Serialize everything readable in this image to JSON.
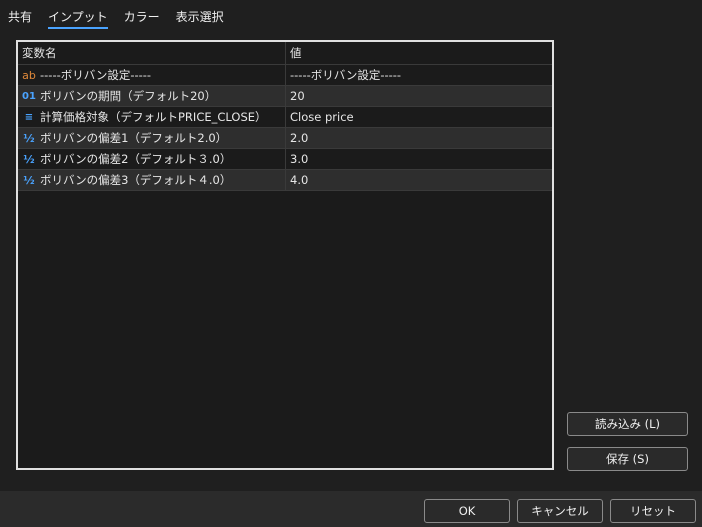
{
  "tabs": [
    {
      "label": "共有"
    },
    {
      "label": "インプット"
    },
    {
      "label": "カラー"
    },
    {
      "label": "表示選択"
    }
  ],
  "grid": {
    "headers": {
      "name": "変数名",
      "value": "値"
    },
    "rows": [
      {
        "icon": "ab",
        "icon_name": "string-type-icon",
        "name": "-----ボリバン設定-----",
        "value": "-----ボリバン設定-----"
      },
      {
        "icon": "01",
        "icon_name": "integer-type-icon",
        "name": "ボリバンの期間（デフォルト20）",
        "value": "20"
      },
      {
        "icon": "≡",
        "icon_name": "enum-type-icon",
        "name": "計算価格対象（デフォルトPRICE_CLOSE）",
        "value": "Close price"
      },
      {
        "icon": "½",
        "icon_name": "double-type-icon",
        "name": "ボリバンの偏差1（デフォルト2.0）",
        "value": "2.0"
      },
      {
        "icon": "½",
        "icon_name": "double-type-icon",
        "name": "ボリバンの偏差2（デフォルト３.0）",
        "value": "3.0"
      },
      {
        "icon": "½",
        "icon_name": "double-type-icon",
        "name": "ボリバンの偏差3（デフォルト４.0）",
        "value": "4.0"
      }
    ]
  },
  "side_buttons": {
    "load": "読み込み (L)",
    "save": "保存 (S)"
  },
  "footer_buttons": {
    "ok": "OK",
    "cancel": "キャンセル",
    "reset": "リセット"
  },
  "colors": {
    "accent": "#4aa3ff",
    "string_icon": "#e0893a"
  }
}
